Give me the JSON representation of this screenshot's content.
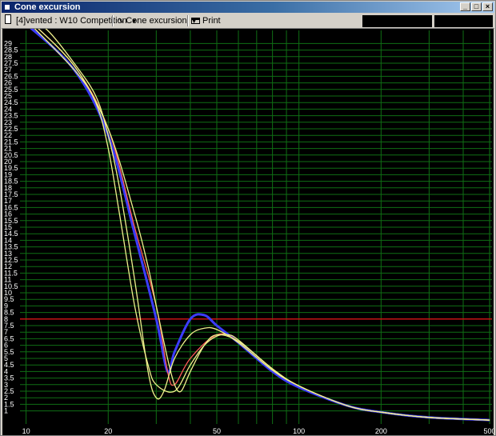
{
  "window": {
    "title": "Cone excursion"
  },
  "toolbar": {
    "project_label": "[4]vented : W10 Competition",
    "view_label": "Cone excursion",
    "print_label": "Print"
  },
  "colors": {
    "grid": "#0f6e14",
    "limit_line": "#c81414",
    "curve_yellow": "#f0f08c",
    "curve_blue": "#3c3cff",
    "curve_red": "#ff5a5a",
    "background": "#000000"
  },
  "chart_data": {
    "type": "line",
    "title": "",
    "xlabel": "",
    "ylabel": "",
    "x_scale": "log",
    "xlim": [
      9.5,
      510
    ],
    "ylim": [
      0,
      30
    ],
    "grid": true,
    "x_tick_labels": [
      "10",
      "20",
      "50",
      "100",
      "200",
      "500"
    ],
    "x_tick_values": [
      10,
      20,
      50,
      100,
      200,
      500
    ],
    "y_tick_labels": [
      "1",
      "1.5",
      "2",
      "2.5",
      "3",
      "3.5",
      "4",
      "4.5",
      "5",
      "5.5",
      "6",
      "6.5",
      "7",
      "7.5",
      "8",
      "8.5",
      "9",
      "9.5",
      "10",
      "10.5",
      "11",
      "11.5",
      "12",
      "12.5",
      "13",
      "13.5",
      "14",
      "14.5",
      "15",
      "15.5",
      "16",
      "16.5",
      "17",
      "17.5",
      "18",
      "18.5",
      "19",
      "19.5",
      "20",
      "20.5",
      "21",
      "21.5",
      "22",
      "22.5",
      "23",
      "23.5",
      "24",
      "24.5",
      "25",
      "25.5",
      "26",
      "26.5",
      "27",
      "27.5",
      "28",
      "28.5",
      "29"
    ],
    "reference_line": {
      "y": 8,
      "color": "#c81414"
    },
    "series": [
      {
        "color": "#3c3cff",
        "points": [
          [
            10,
            30.5
          ],
          [
            15,
            27
          ],
          [
            20,
            22
          ],
          [
            25,
            14.5
          ],
          [
            30,
            8
          ],
          [
            33,
            4
          ],
          [
            35,
            5.5
          ],
          [
            40,
            8
          ],
          [
            45,
            8.3
          ],
          [
            50,
            7.5
          ],
          [
            60,
            6.2
          ],
          [
            80,
            4
          ],
          [
            100,
            2.8
          ],
          [
            150,
            1.4
          ],
          [
            200,
            0.9
          ],
          [
            300,
            0.5
          ],
          [
            500,
            0.3
          ]
        ]
      },
      {
        "color": "#ff5a5a",
        "points": [
          [
            10,
            31
          ],
          [
            15,
            27.3
          ],
          [
            20,
            22.5
          ],
          [
            25,
            15
          ],
          [
            30,
            9
          ],
          [
            33,
            4
          ],
          [
            35,
            3
          ],
          [
            40,
            5
          ],
          [
            50,
            6.8
          ],
          [
            60,
            6.3
          ],
          [
            80,
            4.2
          ],
          [
            100,
            2.9
          ],
          [
            150,
            1.4
          ],
          [
            200,
            0.9
          ],
          [
            300,
            0.5
          ],
          [
            500,
            0.3
          ]
        ]
      },
      {
        "color": "#f0f08c",
        "points": [
          [
            10,
            31
          ],
          [
            12,
            30
          ],
          [
            15,
            27.5
          ],
          [
            18,
            25
          ],
          [
            20,
            22
          ],
          [
            22,
            18
          ],
          [
            25,
            11
          ],
          [
            28,
            4
          ],
          [
            30,
            2
          ],
          [
            32,
            2.5
          ],
          [
            35,
            5
          ],
          [
            40,
            6.8
          ],
          [
            45,
            7.3
          ],
          [
            50,
            7.2
          ],
          [
            60,
            6.2
          ],
          [
            80,
            4.1
          ],
          [
            100,
            2.9
          ],
          [
            150,
            1.4
          ],
          [
            200,
            0.9
          ],
          [
            300,
            0.5
          ],
          [
            500,
            0.3
          ]
        ]
      },
      {
        "color": "#f0f08c",
        "points": [
          [
            10,
            30.8
          ],
          [
            15,
            27
          ],
          [
            18,
            24.5
          ],
          [
            20,
            21
          ],
          [
            22,
            16
          ],
          [
            25,
            9
          ],
          [
            28,
            4.5
          ],
          [
            30,
            3
          ],
          [
            35,
            2.5
          ],
          [
            40,
            4.5
          ],
          [
            45,
            6
          ],
          [
            50,
            6.7
          ],
          [
            55,
            6.8
          ],
          [
            60,
            6.4
          ],
          [
            80,
            4.2
          ],
          [
            100,
            2.9
          ],
          [
            150,
            1.4
          ],
          [
            200,
            0.9
          ],
          [
            300,
            0.5
          ],
          [
            500,
            0.3
          ]
        ]
      },
      {
        "color": "#f0f08c",
        "points": [
          [
            10,
            31
          ],
          [
            15,
            27.3
          ],
          [
            20,
            22.5
          ],
          [
            25,
            16
          ],
          [
            28,
            12
          ],
          [
            30,
            9
          ],
          [
            33,
            5
          ],
          [
            35,
            3
          ],
          [
            37,
            2.5
          ],
          [
            40,
            4
          ],
          [
            45,
            6
          ],
          [
            50,
            6.8
          ],
          [
            60,
            6.3
          ],
          [
            80,
            4.2
          ],
          [
            100,
            2.9
          ],
          [
            150,
            1.4
          ],
          [
            200,
            0.9
          ],
          [
            300,
            0.5
          ],
          [
            500,
            0.3
          ]
        ]
      }
    ]
  }
}
